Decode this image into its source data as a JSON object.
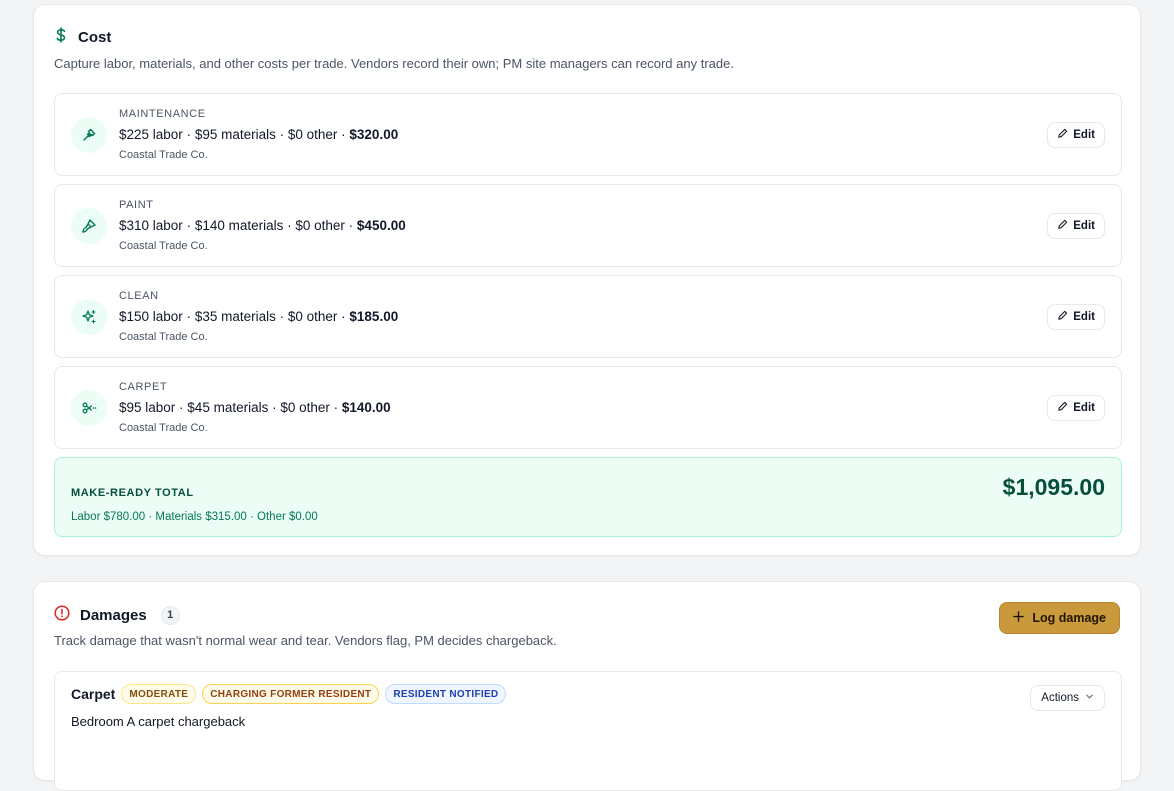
{
  "cost": {
    "title": "Cost",
    "description": "Capture labor, materials, and other costs per trade. Vendors record their own; PM site managers can record any trade.",
    "trades": [
      {
        "name": "MAINTENANCE",
        "labor": "$225 labor",
        "materials": "$95 materials",
        "other": "$0 other",
        "total": "$320.00",
        "vendor": "Coastal Trade Co.",
        "icon": "hammer-icon"
      },
      {
        "name": "PAINT",
        "labor": "$310 labor",
        "materials": "$140 materials",
        "other": "$0 other",
        "total": "$450.00",
        "vendor": "Coastal Trade Co.",
        "icon": "paintbrush-icon"
      },
      {
        "name": "CLEAN",
        "labor": "$150 labor",
        "materials": "$35 materials",
        "other": "$0 other",
        "total": "$185.00",
        "vendor": "Coastal Trade Co.",
        "icon": "sparkles-icon"
      },
      {
        "name": "CARPET",
        "labor": "$95 labor",
        "materials": "$45 materials",
        "other": "$0 other",
        "total": "$140.00",
        "vendor": "Coastal Trade Co.",
        "icon": "scissors-icon"
      }
    ],
    "edit_label": "Edit",
    "total": {
      "label": "MAKE-READY TOTAL",
      "breakdown": "Labor $780.00 · Materials $315.00 · Other $0.00",
      "amount": "$1,095.00"
    },
    "accent_color": "#047857"
  },
  "damages": {
    "title": "Damages",
    "count": "1",
    "description": "Track damage that wasn't normal wear and tear. Vendors flag, PM decides chargeback.",
    "log_button": "Log damage",
    "items": [
      {
        "name": "Carpet",
        "badges": [
          "MODERATE",
          "CHARGING FORMER RESIDENT",
          "RESIDENT NOTIFIED"
        ],
        "description": "Bedroom A carpet chargeback",
        "actions_label": "Actions"
      }
    ],
    "alert_color": "#dc2626",
    "button_color": "#c9993b"
  }
}
